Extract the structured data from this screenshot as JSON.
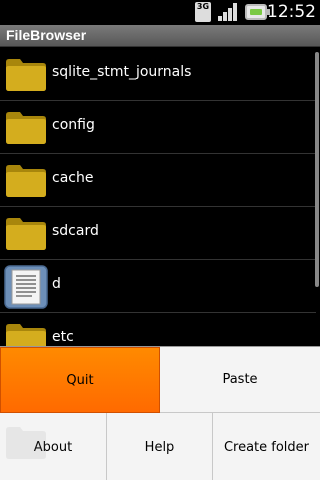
{
  "status_bar": {
    "network": "3G",
    "time": "12:52",
    "icons": [
      "network-3g-icon",
      "signal-strength-icon",
      "battery-icon"
    ]
  },
  "app": {
    "title": "FileBrowser"
  },
  "files": [
    {
      "name": "sqlite_stmt_journals",
      "type": "folder"
    },
    {
      "name": "config",
      "type": "folder"
    },
    {
      "name": "cache",
      "type": "folder"
    },
    {
      "name": "sdcard",
      "type": "folder"
    },
    {
      "name": "d",
      "type": "file"
    },
    {
      "name": "etc",
      "type": "folder"
    }
  ],
  "menu": {
    "quit": "Quit",
    "paste": "Paste",
    "about": "About",
    "help": "Help",
    "create_folder": "Create folder",
    "selected": "quit"
  },
  "colors": {
    "folder": "#c8a214",
    "menu_highlight": "#ff7a00",
    "title_bar": "#6a6a6a",
    "background": "#000000"
  }
}
